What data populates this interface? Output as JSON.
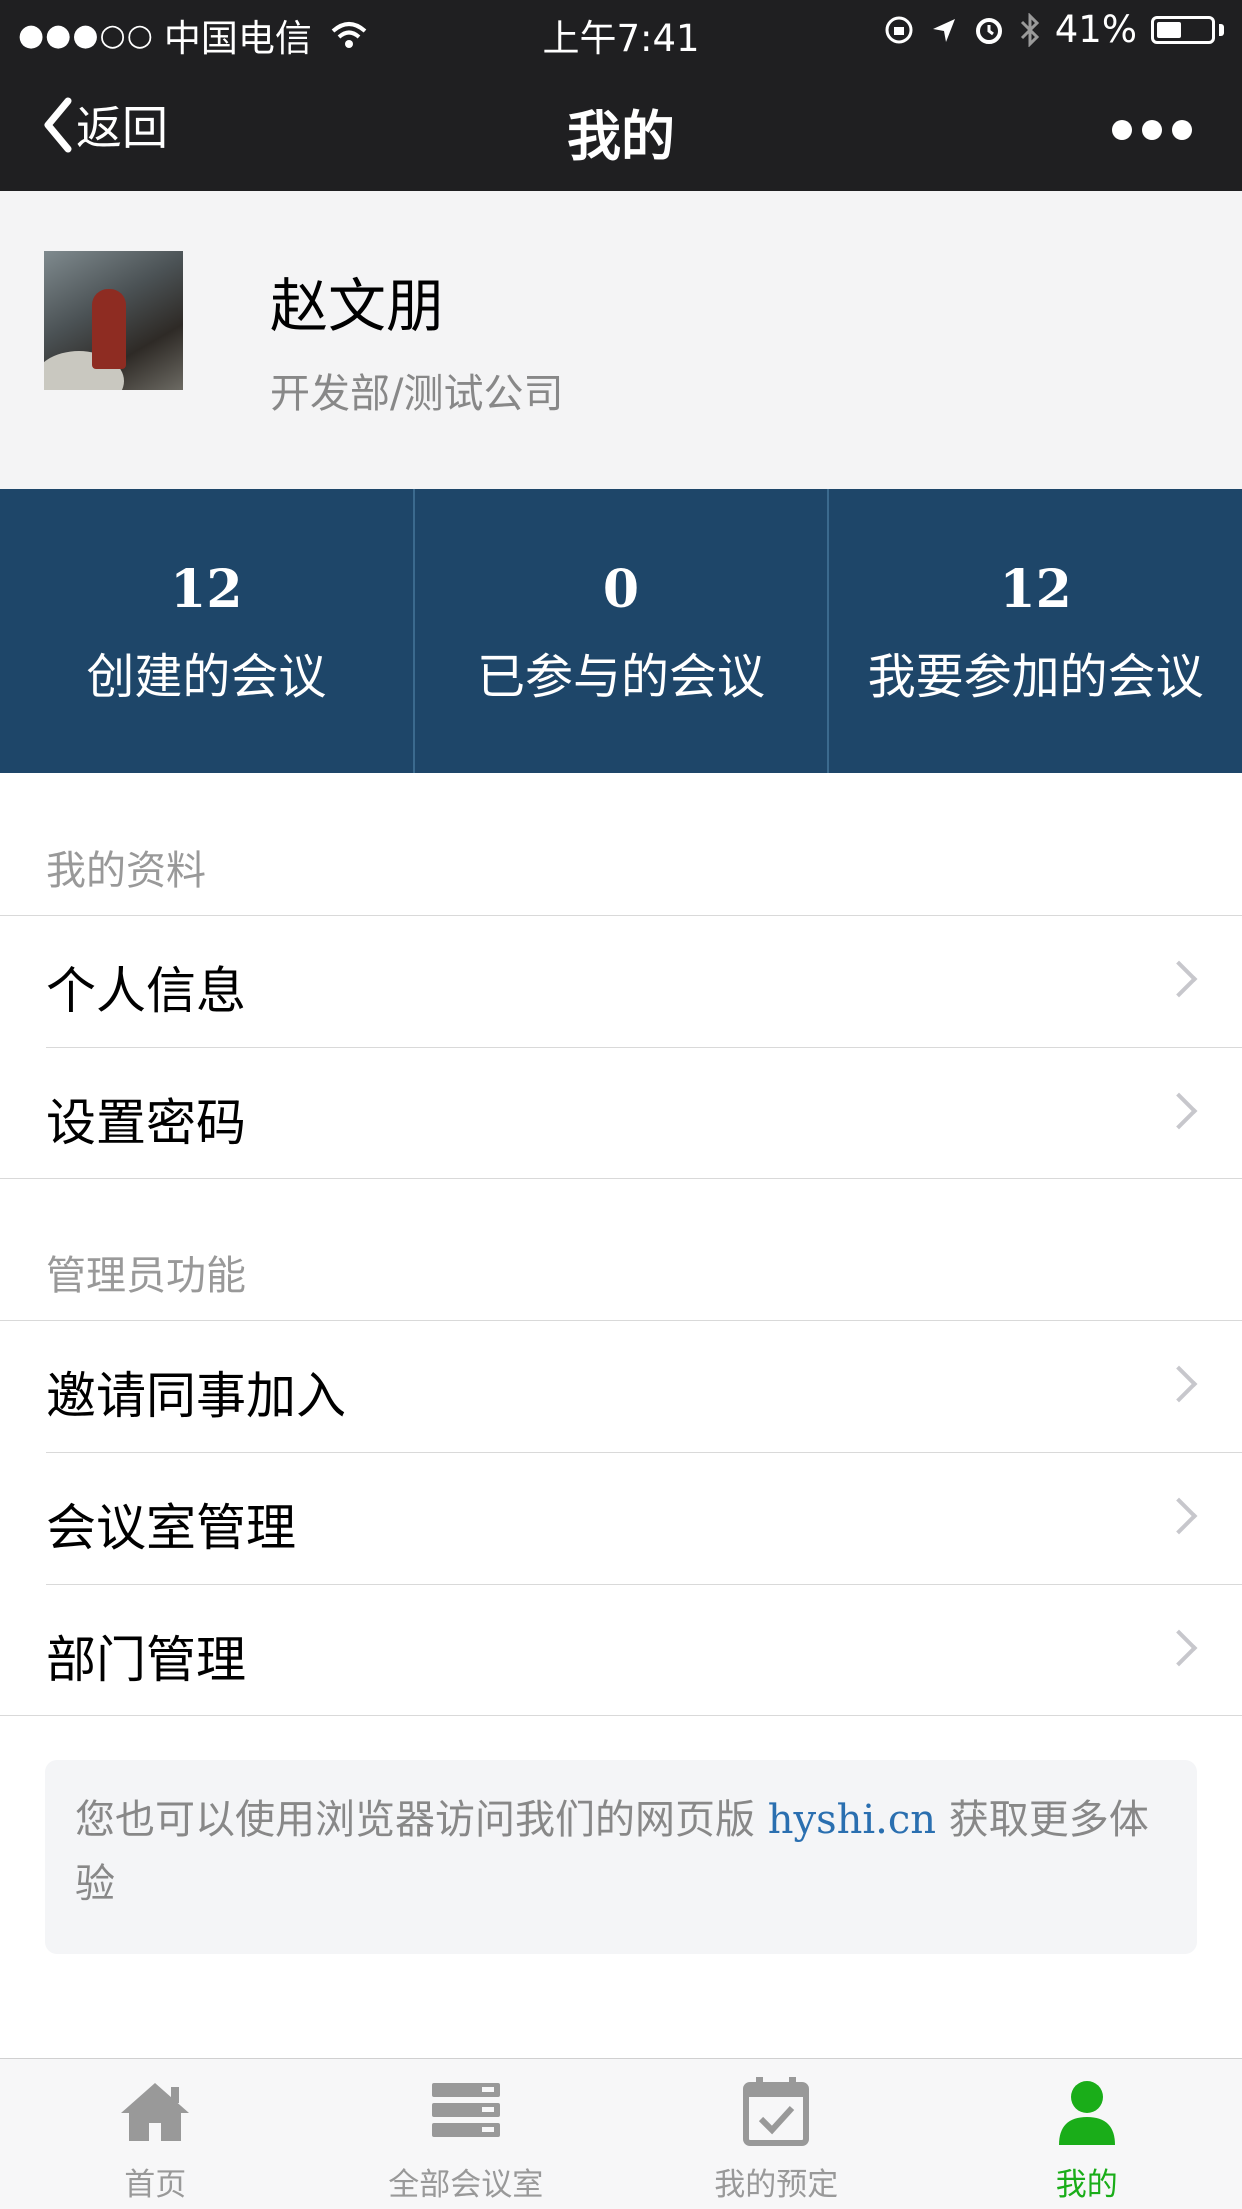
{
  "status_bar": {
    "signal": "●●●○○",
    "carrier": "中国电信",
    "time": "上午7:41",
    "battery": "41%"
  },
  "nav": {
    "back_label": "返回",
    "title": "我的"
  },
  "profile": {
    "name": "赵文朋",
    "department": "开发部/测试公司"
  },
  "stats": [
    {
      "value": "12",
      "label": "创建的会议"
    },
    {
      "value": "0",
      "label": "已参与的会议"
    },
    {
      "value": "12",
      "label": "我要参加的会议"
    }
  ],
  "section_profile": {
    "title": "我的资料",
    "items": [
      {
        "label": "个人信息"
      },
      {
        "label": "设置密码"
      }
    ]
  },
  "section_admin": {
    "title": "管理员功能",
    "items": [
      {
        "label": "邀请同事加入"
      },
      {
        "label": "会议室管理"
      },
      {
        "label": "部门管理"
      }
    ]
  },
  "notice": {
    "text_before": "您也可以使用浏览器访问我们的网页版",
    "link": "hyshi.cn",
    "text_after": "获取更多体验"
  },
  "tabs": [
    {
      "label": "首页",
      "icon": "home-icon"
    },
    {
      "label": "全部会议室",
      "icon": "server-icon"
    },
    {
      "label": "我的预定",
      "icon": "calendar-check-icon"
    },
    {
      "label": "我的",
      "icon": "user-icon",
      "active": true
    }
  ],
  "colors": {
    "header_bg": "#1f1f21",
    "stats_bg": "#1e4669",
    "active_tab": "#1aad19",
    "link": "#2a6fb0"
  }
}
